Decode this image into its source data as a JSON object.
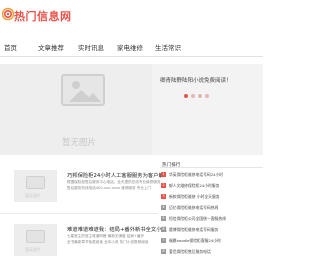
{
  "header": {
    "logo_text": "热门信息网",
    "brand_color": "#e8534a"
  },
  "nav": [
    {
      "label": "首页"
    },
    {
      "label": "文章推荐"
    },
    {
      "label": "实时讯息"
    },
    {
      "label": "家电维修"
    },
    {
      "label": "生活常识"
    }
  ],
  "slider": {
    "placeholder_caption": "暂无图片",
    "title": "卿青陆野陆阳小说免费阅读！",
    "dots": 4,
    "active_dot": 1
  },
  "articles": [
    {
      "thumb_caption": "暂无图片",
      "title": "巧邦保险柜24小时人工客服服务为客户解",
      "lines": [
        "根据保险柜售后服务中心电话，全天提供在线专业维修服务",
        "售后服务热线电话400-xxx-xxxx 维修服务 专业上门"
      ]
    },
    {
      "thumb_caption": "暂无图片",
      "title": "难道难道难道我：结局+番外新书全文小说",
      "lines": [
        "七星宫主的宫主难道阿嬷 最新无弹窗 结局+番外",
        "全书最新章节免费阅读 全本小说 热门小说推荐阅读"
      ]
    }
  ],
  "sidebar": {
    "heading": "热门排行",
    "items": [
      {
        "rank": "1",
        "text": "华英保险柜维修电话号码24小时"
      },
      {
        "rank": "2",
        "text": "郁人文维修保险柜24小时服务"
      },
      {
        "rank": "3",
        "text": "新款保险柜维修 小时全天服务"
      },
      {
        "rank": "4",
        "text": "迈亿保险柜维修电话号码热线"
      },
      {
        "rank": "5",
        "text": "恒信保险柜公司全国统一客服热线"
      },
      {
        "rank": "6",
        "text": "晨博保险柜维修电话号码服务"
      },
      {
        "rank": "7",
        "text": "福鼎noodle保险柜客服24小时"
      },
      {
        "rank": "8",
        "text": "爱侣保险柜售后服务电话"
      }
    ]
  }
}
